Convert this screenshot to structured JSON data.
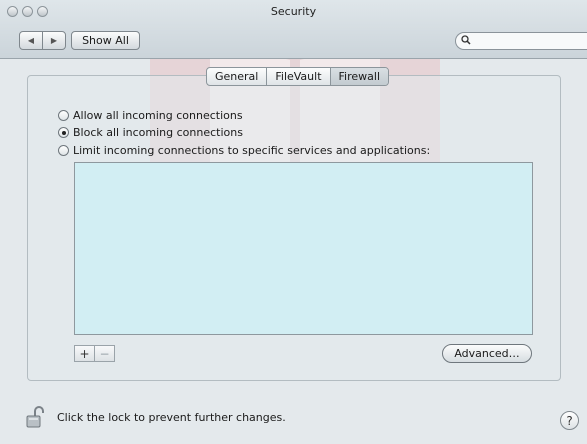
{
  "window": {
    "title": "Security"
  },
  "toolbar": {
    "back_icon": "triangle-left-icon",
    "forward_icon": "triangle-right-icon",
    "show_all_label": "Show All",
    "search_placeholder": ""
  },
  "tabs": [
    {
      "label": "General",
      "active": false
    },
    {
      "label": "FileVault",
      "active": false
    },
    {
      "label": "Firewall",
      "active": true
    }
  ],
  "firewall": {
    "options": [
      {
        "label": "Allow all incoming connections",
        "selected": false
      },
      {
        "label": "Block all incoming connections",
        "selected": true
      },
      {
        "label": "Limit incoming connections to specific services and applications:",
        "selected": false
      }
    ],
    "add_label": "+",
    "remove_label": "−",
    "advanced_label": "Advanced…"
  },
  "footer": {
    "lock_text": "Click the lock to prevent further changes.",
    "help_label": "?"
  }
}
